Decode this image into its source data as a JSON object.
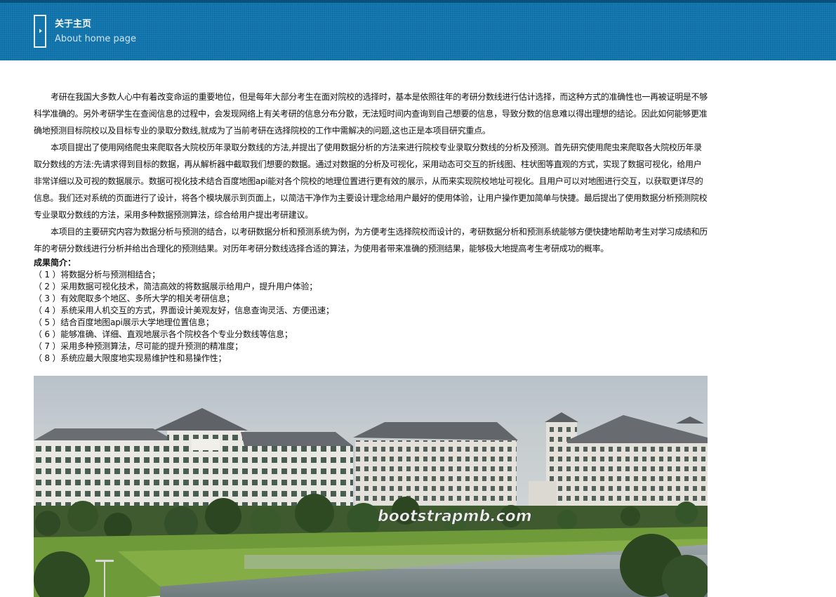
{
  "header": {
    "title": "关于主页",
    "subtitle": "About home page"
  },
  "intro": {
    "paragraphs": [
      "考研在我国大多数人心中有着改变命运的重要地位，但是每年大部分考生在面对院校的选择时，基本是依照往年的考研分数线进行估计选择，而这种方式的准确性也一再被证明是不够科学准确的。另外考研学生在查阅信息的过程中，会发现网络上有关考研的信息分布分散，无法短时间内查询到自己想要的信息，导致分数的信息难以得出理想的结论。因此如何能够更准确地预测目标院校以及目标专业的录取分数线,就成为了当前考研在选择院校的工作中需解决的问题,这也正是本项目研究重点。",
      "本项目提出了使用网络爬虫来爬取各大院校历年录取分数线的方法,并提出了使用数据分析的方法来进行院校专业录取分数线的分析及预测。首先研究使用爬虫来爬取各大院校历年录取分数线的方法:先请求得到目标的数据，再从解析器中截取我们想要的数据。通过对数据的分析及可视化，采用动态可交互的折线图、柱状图等直观的方式，实现了数据可视化，给用户非常详细以及可视的数据展示。数据可视化技术结合百度地图api能对各个院校的地理位置进行更有效的展示，从而来实现院校地址可视化。且用户可以对地图进行交互，以获取更详尽的信息。我们还对系统的页面进行了设计，将各个模块展示到页面上，以简洁干净作为主要设计理念给用户最好的使用体验，让用户操作更加简单与快捷。最后提出了使用数据分析预测院校专业录取分数线的方法，采用多种数据预测算法，综合给用户提出考研建议。",
      "本项目的主要研究内容为数据分析与预测的结合，以考研数据分析和预测系统为例，为方便考生选择院校而设计的，考研数据分析和预测系统能够方便快捷地帮助考生对学习成绩和历年的考研分数线进行分析并给出合理化的预测结果。对历年考研分数线选择合适的算法，为使用者带来准确的预测结果，能够极大地提高考生考研成功的概率。"
    ]
  },
  "summary": {
    "title": "成果简介：",
    "items": [
      "（ 1 ）将数据分析与预测相结合；",
      "（ 2 ）采用数据可视化技术，简洁高效的将数据展示给用户，提升用户体验；",
      "（ 3 ）有效爬取多个地区、多所大学的相关考研信息；",
      "（ 4 ）系统采用人机交互的方式，界面设计美观友好，信息查询灵活、方便迅速；",
      "（ 5 ）结合百度地图api展示大学地理位置信息；",
      "（ 6 ）能够准确、详细、直观地展示各个院校各个专业分数线等信息；",
      "（ 7 ）采用多种预测算法，尽可能的提升预测的精准度；",
      "（ 8 ）系统应最大限度地实现易维护性和易操作性；"
    ]
  },
  "image": {
    "watermark": "bootstrapmb.com"
  },
  "colors": {
    "header_bg": "#0a6fa8",
    "header_title": "#ffffff",
    "header_subtitle": "#cfe3f2",
    "body_text": "#111111"
  },
  "icons": {
    "header": "page-marker-icon"
  }
}
